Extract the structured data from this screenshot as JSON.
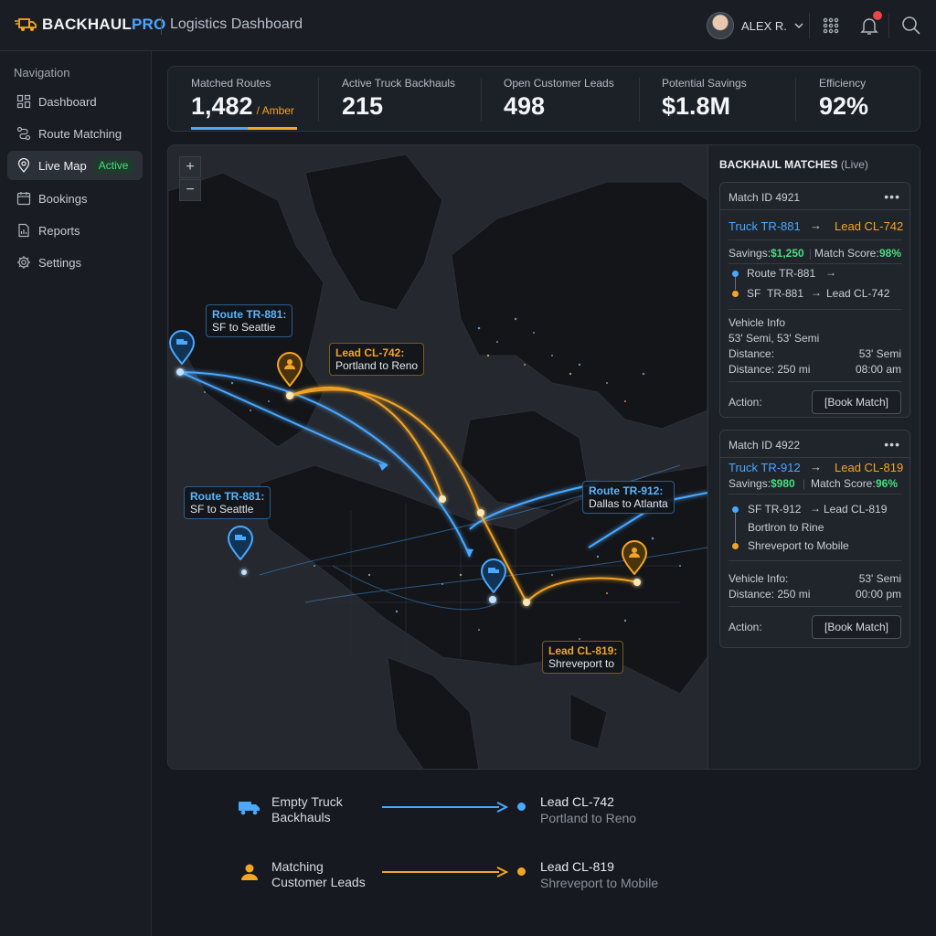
{
  "header": {
    "brand_part1": "BACKHAUL",
    "brand_part2": "PRO",
    "page_title": "Logistics Dashboard",
    "user_name": "ALEX R."
  },
  "sidebar": {
    "heading": "Navigation",
    "items": [
      {
        "label": "Dashboard",
        "icon": "dashboard-icon"
      },
      {
        "label": "Route Matching",
        "icon": "route-icon"
      },
      {
        "label": "Live Map",
        "icon": "map-pin-icon",
        "badge": "Active"
      },
      {
        "label": "Bookings",
        "icon": "calendar-icon"
      },
      {
        "label": "Reports",
        "icon": "report-icon"
      },
      {
        "label": "Settings",
        "icon": "gear-icon"
      }
    ]
  },
  "stats": [
    {
      "label": "Matched Routes",
      "value": "1,482",
      "sub": "/ Amber"
    },
    {
      "label": "Active Truck Backhauls",
      "value": "215"
    },
    {
      "label": "Open Customer Leads",
      "value": "498"
    },
    {
      "label": "Potential Savings",
      "value": "$1.8M"
    },
    {
      "label": "Efficiency",
      "value": "92%"
    }
  ],
  "map": {
    "zoom_in": "+",
    "zoom_out": "−",
    "labels": [
      {
        "line1": "Route TR-881:",
        "line2": "SF to Seattie"
      },
      {
        "line1": "Lead CL-742:",
        "line2": "Portland to Reno"
      },
      {
        "line1": "Route TR-881:",
        "line2": "SF to Seattle"
      },
      {
        "line1": "Route TR-912:",
        "line2": "Dallas to Atlanta"
      },
      {
        "line1": "Lead CL-819:",
        "line2": "Shreveport to"
      }
    ]
  },
  "panel": {
    "title": "BACKHAUL MATCHES",
    "title_suffix": "(Live)",
    "cards": [
      {
        "id": "Match ID 4921",
        "truck": "Truck TR-881",
        "lead": "Lead CL-742",
        "savings_label": "Savings:",
        "savings": "$1,250",
        "score_label": "Match Score:",
        "score": "98%",
        "route1": "Route TR-881",
        "route2_a": "SF",
        "route2_b": "TR-881",
        "route2_c": "Lead CL-742",
        "vehicle_heading": "Vehicle Info",
        "vehicle_line": "53' Semi, 53' Semi",
        "distance_label1": "Distance:",
        "distance_val1": "53' Semi",
        "distance_label2": "Distance: 250 mi",
        "time": "08:00 am",
        "action_label": "Action:",
        "button": "[Book Match]"
      },
      {
        "id": "Match ID 4922",
        "truck": "Truck TR-912",
        "lead": "Lead CL-819",
        "savings_label": "Savings:",
        "savings": "$980",
        "score_label": "Match Score:",
        "score": "96%",
        "route1_a": "SF TR-912",
        "route1_b": "Lead CL-819",
        "route2": "Bortlron to Rine",
        "route3": "Shreveport to Mobile",
        "vehicle_label": "Vehicle Info:",
        "vehicle_val": "53' Semi",
        "distance_label": "Distance: 250 mi",
        "time": "00:00 pm",
        "action_label": "Action:",
        "button": "[Book Match]"
      }
    ]
  },
  "legend": [
    {
      "line1": "Empty Truck",
      "line2": "Backhauls",
      "lead": "Lead CL-742",
      "route": "Portland to Reno",
      "color": "#4aa8ff"
    },
    {
      "line1": "Matching",
      "line2": "Customer Leads",
      "lead": "Lead CL-819",
      "route": "Shreveport to Mobile",
      "color": "#f5a524"
    }
  ],
  "colors": {
    "accent_blue": "#4aa8ff",
    "accent_amber": "#f5a524",
    "success": "#4ade80",
    "alert": "#ef4444"
  }
}
